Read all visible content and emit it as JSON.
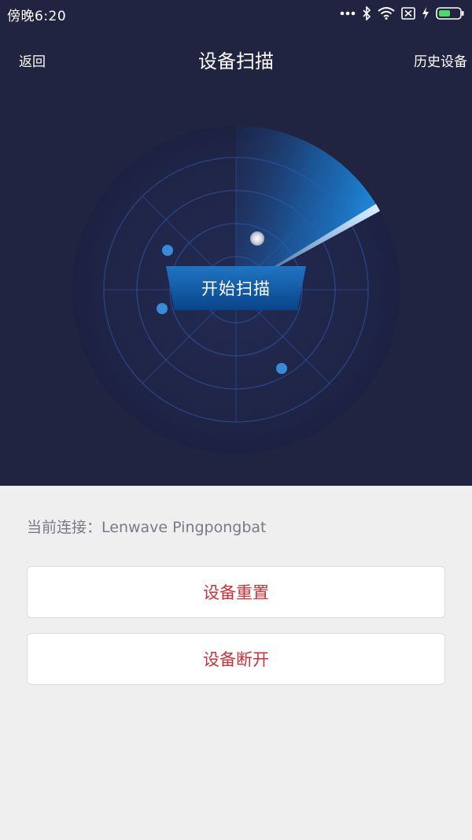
{
  "status_bar": {
    "time": "傍晚6:20",
    "icons": [
      "more-dots-icon",
      "bluetooth-icon",
      "wifi-icon",
      "sim-card-icon",
      "charging-icon",
      "battery-icon"
    ]
  },
  "nav": {
    "back_label": "返回",
    "title": "设备扫描",
    "history_label": "历史设备"
  },
  "radar": {
    "scan_button_label": "开始扫描"
  },
  "connection": {
    "current_label": "当前连接：Lenwave Pingpongbat"
  },
  "actions": {
    "reset_label": "设备重置",
    "disconnect_label": "设备断开"
  },
  "colors": {
    "header_bg": "#212440",
    "radar_blue": "#1a7fd0",
    "danger_text": "#c8323a",
    "page_bg": "#efeff0"
  }
}
